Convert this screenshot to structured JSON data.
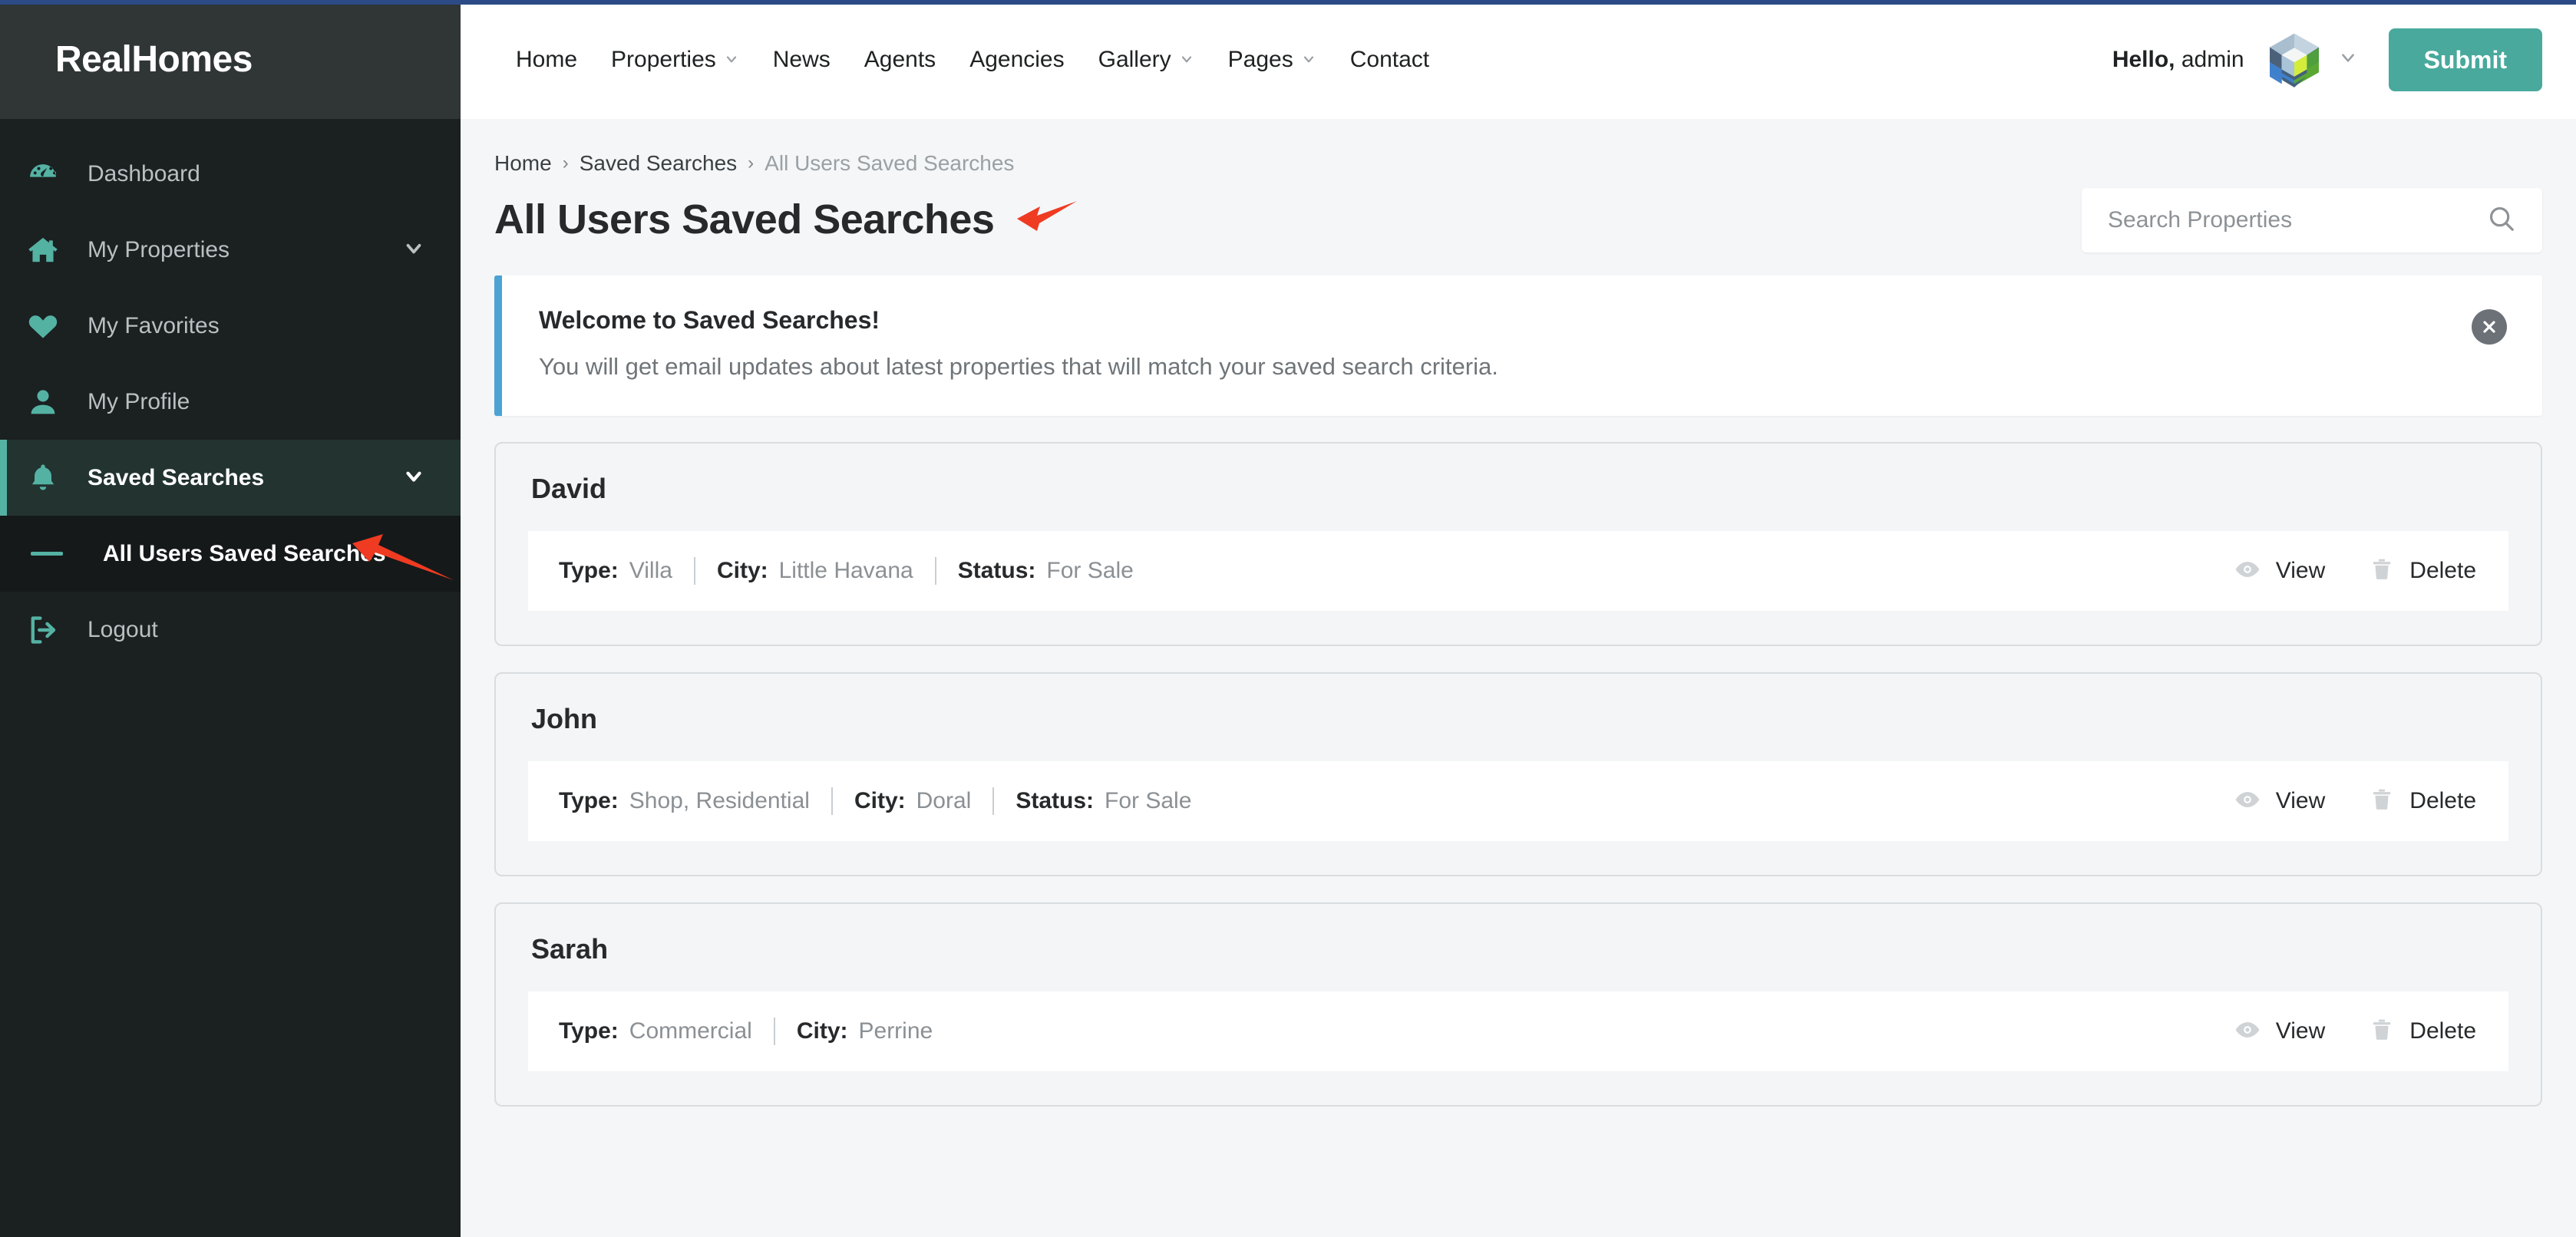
{
  "brand": {
    "name": "RealHomes"
  },
  "sidebar": {
    "items": [
      {
        "label": "Dashboard",
        "icon": "dashboard-gauge-icon",
        "caret": false,
        "active": false
      },
      {
        "label": "My Properties",
        "icon": "home-icon",
        "caret": true,
        "active": false
      },
      {
        "label": "My Favorites",
        "icon": "heart-icon",
        "caret": false,
        "active": false
      },
      {
        "label": "My Profile",
        "icon": "user-icon",
        "caret": false,
        "active": false
      },
      {
        "label": "Saved Searches",
        "icon": "bell-icon",
        "caret": true,
        "active": true
      }
    ],
    "submenu": [
      {
        "label": "All Users Saved Searches",
        "icon": "dash-icon",
        "active": true
      }
    ],
    "logout": {
      "label": "Logout",
      "icon": "logout-icon"
    }
  },
  "topnav": {
    "items": [
      {
        "label": "Home",
        "caret": false
      },
      {
        "label": "Properties",
        "caret": true
      },
      {
        "label": "News",
        "caret": false
      },
      {
        "label": "Agents",
        "caret": false
      },
      {
        "label": "Agencies",
        "caret": false
      },
      {
        "label": "Gallery",
        "caret": true
      },
      {
        "label": "Pages",
        "caret": true
      },
      {
        "label": "Contact",
        "caret": false
      }
    ],
    "greeting_prefix": "Hello,",
    "greeting_user": "admin",
    "submit_label": "Submit",
    "avatar_name": "user-avatar-cube-logo"
  },
  "breadcrumb": {
    "items": [
      "Home",
      "Saved Searches",
      "All Users Saved Searches"
    ],
    "separator": "›"
  },
  "page": {
    "title": "All Users Saved Searches"
  },
  "search": {
    "placeholder": "Search Properties",
    "value": ""
  },
  "notice": {
    "title": "Welcome to Saved Searches!",
    "text": "You will get email updates about latest properties that will match your saved search criteria.",
    "close_label": "✕",
    "accent_color": "#4ba3d4"
  },
  "labels": {
    "type": "Type:",
    "city": "City:",
    "status": "Status:",
    "view": "View",
    "delete": "Delete"
  },
  "saved_searches": [
    {
      "name": "David",
      "type": "Villa",
      "city": "Little Havana",
      "status": "For Sale",
      "view_label": "View",
      "delete_label": "Delete"
    },
    {
      "name": "John",
      "type": "Shop, Residential",
      "city": "Doral",
      "status": "For Sale",
      "view_label": "View",
      "delete_label": "Delete"
    },
    {
      "name": "Sarah",
      "type": "Commercial",
      "city": "Perrine",
      "status": null,
      "view_label": "View",
      "delete_label": "Delete"
    }
  ],
  "theme": {
    "accent_teal": "#48a99c",
    "sidebar_bg": "#1b2021",
    "sidebar_brand_bg": "#303535",
    "sidebar_active_bg": "#223330",
    "content_bg": "#f4f6f8",
    "annotation_red": "#ef3b22"
  }
}
